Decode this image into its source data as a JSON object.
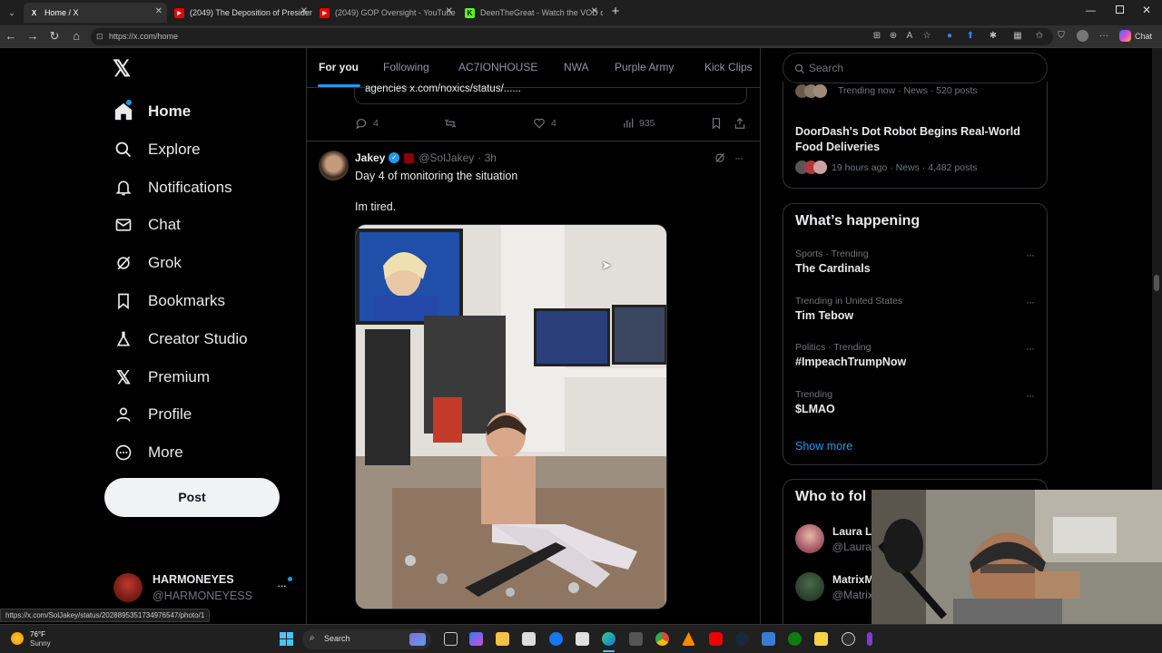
{
  "browser": {
    "tabs": [
      {
        "title": "Home / X",
        "active": true
      },
      {
        "title": "(2049) The Deposition of President",
        "active": false
      },
      {
        "title": "(2049) GOP Oversight - YouTube",
        "active": false
      },
      {
        "title": "DeenTheGreat - Watch the VOD o",
        "active": false
      }
    ],
    "url": "https://x.com/home",
    "chat_label": "Chat",
    "status_url": "https://x.com/SolJakey/status/2028895351734976547/photo/1"
  },
  "sidebar": {
    "items": [
      {
        "label": "Home",
        "icon": "home-icon",
        "active": true
      },
      {
        "label": "Explore",
        "icon": "search-icon"
      },
      {
        "label": "Notifications",
        "icon": "bell-icon"
      },
      {
        "label": "Chat",
        "icon": "mail-icon"
      },
      {
        "label": "Grok",
        "icon": "grok-icon"
      },
      {
        "label": "Bookmarks",
        "icon": "bookmark-icon"
      },
      {
        "label": "Creator Studio",
        "icon": "flask-icon"
      },
      {
        "label": "Premium",
        "icon": "x-logo-icon"
      },
      {
        "label": "Profile",
        "icon": "person-icon"
      },
      {
        "label": "More",
        "icon": "more-circle-icon"
      }
    ],
    "post_label": "Post",
    "account": {
      "name": "HARMONEYES",
      "handle": "@HARMONEYESS"
    }
  },
  "feed": {
    "tabs": [
      "For you",
      "Following",
      "AC7IONHOUSE",
      "NWA",
      "Purple Army",
      "Kick Clips"
    ],
    "prev_post": {
      "quote_text": "agencies x.com/noxics/status/......",
      "replies": "4",
      "likes": "4",
      "views": "935"
    },
    "post": {
      "name": "Jakey",
      "handle": "@SolJakey",
      "time": "· 3h",
      "text1": "Day 4 of monitoring the situation",
      "text2": "Im tired."
    }
  },
  "right": {
    "search_placeholder": "Search",
    "top_news": [
      {
        "meta": "Trending now · News · 520 posts"
      },
      {
        "title": "DoorDash's Dot Robot Begins Real-World Food Deliveries",
        "meta": "19 hours ago · News · 4,482 posts"
      }
    ],
    "happening": {
      "title": "What’s happening",
      "trends": [
        {
          "meta": "Sports · Trending",
          "name": "The Cardinals"
        },
        {
          "meta": "Trending in United States",
          "name": "Tim Tebow"
        },
        {
          "meta": "Politics · Trending",
          "name": "#ImpeachTrumpNow"
        },
        {
          "meta": "Trending",
          "name": "$LMAO"
        }
      ],
      "show_more": "Show more"
    },
    "who_to_follow": {
      "title": "Who to fol",
      "users": [
        {
          "name": "Laura L",
          "handle": "@Laura"
        },
        {
          "name": "MatrixM",
          "handle": "@Matrix"
        }
      ]
    }
  },
  "taskbar": {
    "temp": "76°F",
    "weather": "Sunny",
    "search": "Search"
  },
  "colors": {
    "accent": "#1d9bf0",
    "bg": "#000000",
    "border": "#2f3336",
    "muted": "#71767b"
  }
}
